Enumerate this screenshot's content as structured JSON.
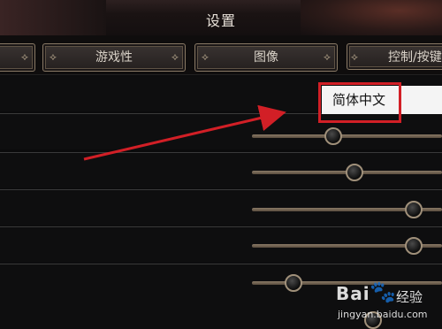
{
  "window": {
    "title": "设置"
  },
  "tabs": [
    {
      "label": ""
    },
    {
      "label": "游戏性"
    },
    {
      "label": "图像"
    },
    {
      "label": "控制/按键"
    }
  ],
  "language": {
    "value": "简体中文"
  },
  "sliders": [
    {
      "value_fraction": 0.43
    },
    {
      "value_fraction": 0.54
    },
    {
      "value_fraction": 0.85
    },
    {
      "value_fraction": 0.85
    },
    {
      "value_fraction": 0.22
    }
  ],
  "annotation": {
    "highlight_color": "#d21f26"
  },
  "watermark": {
    "brand": "Bai",
    "cn": "经验",
    "url": "jingyan.baidu.com"
  }
}
